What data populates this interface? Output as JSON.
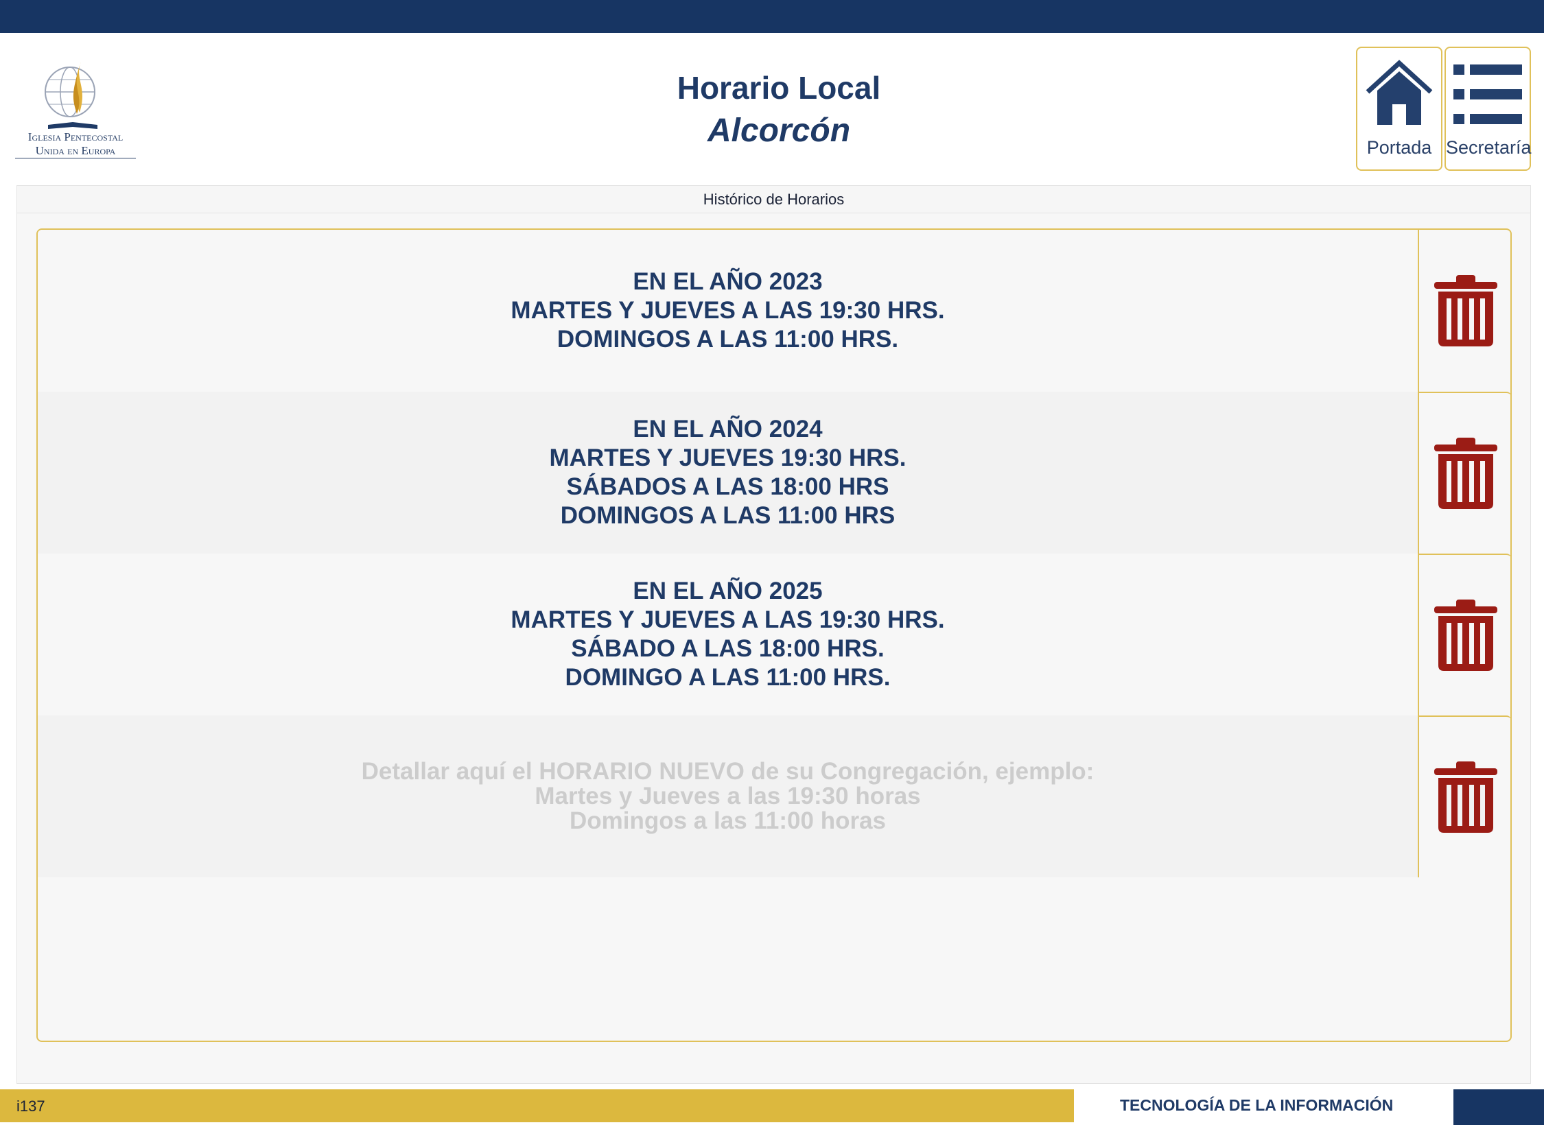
{
  "header": {
    "title": "Horario Local",
    "subtitle": "Alcorcón",
    "logo_lines": [
      "Iglesia Pentecostal",
      "Unida en Europa"
    ]
  },
  "nav": {
    "home_label": "Portada",
    "home_icon": "home-icon",
    "secretaria_label": "Secretaría",
    "secretaria_icon": "list-icon"
  },
  "panel": {
    "title": "Histórico de Horarios"
  },
  "schedules": [
    {
      "text": "EN EL AÑO 2023\nMARTES Y JUEVES A LAS 19:30 HRS.\nDOMINGOS A LAS 11:00 HRS."
    },
    {
      "text": "EN EL AÑO 2024\nMARTES Y JUEVES 19:30 HRS.\nSÁBADOS A LAS 18:00 HRS\nDOMINGOS A LAS 11:00 HRS"
    },
    {
      "text": "EN EL AÑO 2025\nMARTES Y JUEVES A LAS 19:30 HRS.\nSÁBADO A LAS 18:00 HRS.\nDOMINGO A LAS 11:00 HRS."
    },
    {
      "text": "",
      "placeholder": "Detallar aquí el HORARIO NUEVO de su Congregación, ejemplo:\nMartes y Jueves a las 19:30 horas\nDomingos a las 11:00 horas"
    }
  ],
  "footer": {
    "page_id": "i137",
    "department": "TECNOLOGÍA DE LA INFORMACIÓN"
  },
  "colors": {
    "navy": "#173563",
    "gold": "#dcb83e",
    "trash_red": "#9b1c15",
    "text_navy": "#1f3a66"
  }
}
